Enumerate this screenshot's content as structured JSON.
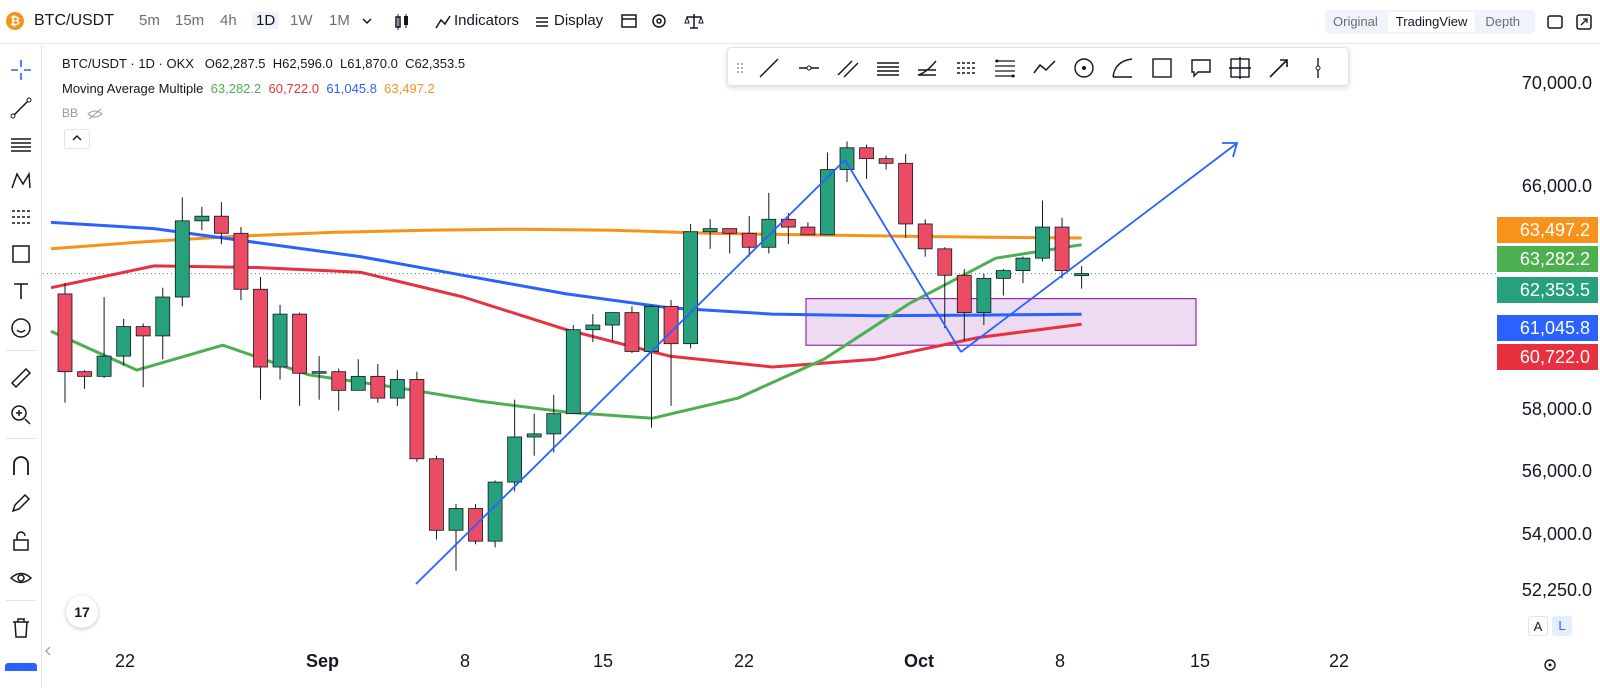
{
  "topbar": {
    "symbol": "BTC/USDT",
    "coin_glyph": "₿",
    "timeframes": [
      "5m",
      "15m",
      "4h",
      "1D",
      "1W",
      "1M"
    ],
    "active_timeframe": "1D",
    "indicators_label": "Indicators",
    "display_label": "Display",
    "views": [
      "Original",
      "TradingView",
      "Depth"
    ],
    "active_view": "TradingView"
  },
  "legend": {
    "title": "BTC/USDT · 1D · OKX",
    "open": "O62,287.5",
    "high": "H62,596.0",
    "low": "L61,870.0",
    "close": "C62,353.5",
    "ma_name": "Moving Average Multiple",
    "ma_values": [
      "63,282.2",
      "60,722.0",
      "61,045.8",
      "63,497.2"
    ],
    "bb_label": "BB"
  },
  "colors": {
    "up": "#26a17b",
    "down": "#eb4b63",
    "ma_green": "#4caf50",
    "ma_red": "#e8303f",
    "ma_blue": "#2962ff",
    "ma_orange": "#f7931a",
    "trend": "#2962ff",
    "box_fill": "#e9d3ee",
    "box_stroke": "#9c27b0"
  },
  "price_axis": {
    "ticks": [
      "70,000.0",
      "66,000.0",
      "58,000.0",
      "56,000.0",
      "54,000.0",
      "52,250.0"
    ],
    "labels": [
      {
        "value": "63,497.2",
        "color": "#f7931a"
      },
      {
        "value": "63,282.2",
        "color": "#4caf50"
      },
      {
        "value": "62,353.5",
        "color": "#26a17b"
      },
      {
        "value": "61,045.8",
        "color": "#2962ff"
      },
      {
        "value": "60,722.0",
        "color": "#e8303f"
      }
    ]
  },
  "date_axis": {
    "ticks": [
      "22",
      "Sep",
      "8",
      "15",
      "22",
      "Oct",
      "8",
      "15",
      "22"
    ]
  },
  "chart_data": {
    "type": "candlestick",
    "candles": [
      [
        61700,
        62050,
        58200,
        59200
      ],
      [
        59200,
        59250,
        58650,
        59050
      ],
      [
        59050,
        61600,
        59000,
        59700
      ],
      [
        59700,
        60900,
        59400,
        60650
      ],
      [
        60650,
        60750,
        58700,
        60350
      ],
      [
        60350,
        61900,
        59600,
        61600
      ],
      [
        61600,
        64800,
        61300,
        64050
      ],
      [
        64050,
        64500,
        63750,
        64200
      ],
      [
        64200,
        64650,
        63300,
        63650
      ],
      [
        63650,
        63850,
        61500,
        61850
      ],
      [
        61850,
        62250,
        58300,
        59350
      ],
      [
        59350,
        61350,
        58950,
        61050
      ],
      [
        61050,
        61100,
        58100,
        59150
      ],
      [
        59150,
        59700,
        58300,
        59200
      ],
      [
        59200,
        59300,
        57950,
        58600
      ],
      [
        58600,
        59600,
        58800,
        59050
      ],
      [
        59050,
        59450,
        58200,
        58350
      ],
      [
        58350,
        59250,
        58100,
        58950
      ],
      [
        58950,
        59200,
        56300,
        56400
      ],
      [
        56400,
        56500,
        53800,
        54100
      ],
      [
        54100,
        54950,
        52800,
        54800
      ],
      [
        54800,
        54950,
        53650,
        53750
      ],
      [
        53750,
        55700,
        53550,
        55650
      ],
      [
        55650,
        58300,
        55350,
        57100
      ],
      [
        57100,
        57850,
        56500,
        57200
      ],
      [
        57200,
        58450,
        56600,
        57850
      ],
      [
        57850,
        60700,
        57900,
        60550
      ],
      [
        60550,
        61050,
        60150,
        60700
      ],
      [
        60700,
        61000,
        60200,
        61100
      ],
      [
        61100,
        61300,
        59800,
        59850
      ],
      [
        59850,
        61350,
        57400,
        61300
      ],
      [
        61300,
        61500,
        58100,
        60100
      ],
      [
        60100,
        63950,
        59950,
        63700
      ],
      [
        63700,
        64100,
        63150,
        63800
      ],
      [
        63800,
        63750,
        63000,
        63650
      ],
      [
        63650,
        64200,
        62900,
        63200
      ],
      [
        63200,
        64950,
        63000,
        64100
      ],
      [
        64100,
        64300,
        63300,
        63850
      ],
      [
        63850,
        64000,
        63750,
        63600
      ],
      [
        63600,
        66250,
        63750,
        65700
      ],
      [
        65700,
        66600,
        65300,
        66400
      ],
      [
        66400,
        66500,
        65400,
        66050
      ],
      [
        66050,
        66150,
        65700,
        65900
      ],
      [
        65900,
        66200,
        63500,
        63950
      ],
      [
        63950,
        64100,
        62900,
        63150
      ],
      [
        63150,
        63200,
        60600,
        62300
      ],
      [
        62300,
        62500,
        60200,
        61100
      ],
      [
        61100,
        62350,
        60700,
        62200
      ],
      [
        62200,
        62500,
        61650,
        62450
      ],
      [
        62450,
        62900,
        62050,
        62850
      ],
      [
        62850,
        64700,
        62750,
        63850
      ],
      [
        63850,
        64150,
        62200,
        62450
      ],
      [
        62287.5,
        62596,
        61870,
        62353.5
      ]
    ],
    "moving_averages": {
      "orange": [
        63150,
        63380,
        63560,
        63680,
        63750,
        63780,
        63750,
        63650,
        63600,
        63560,
        63520,
        63497
      ],
      "green": [
        60500,
        59250,
        60050,
        59100,
        58700,
        58250,
        57900,
        57700,
        58350,
        59600,
        61400,
        62850,
        63282
      ],
      "red": [
        61900,
        62600,
        62550,
        62400,
        61600,
        60550,
        59700,
        59350,
        59600,
        60300,
        60722
      ],
      "blue": [
        64000,
        63800,
        63350,
        62900,
        62300,
        61700,
        61250,
        61050,
        61000,
        61020,
        61046
      ]
    },
    "annotations": {
      "zone": {
        "price_top": 61550,
        "price_bottom": 60050
      },
      "trendlines": [
        "up-channel",
        "peak-to-low",
        "breakout-arrow"
      ]
    },
    "ylim": [
      51800,
      71300
    ]
  }
}
